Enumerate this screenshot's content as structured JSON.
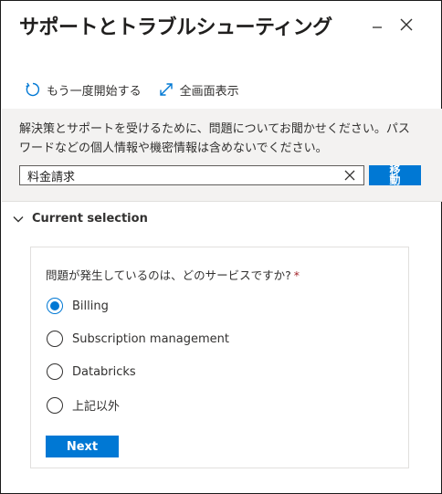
{
  "window": {
    "title": "サポートとトラブルシューティング",
    "minimize_icon": "minimize-icon",
    "close_icon": "close-icon"
  },
  "toolbar": {
    "restart_label": "もう一度開始する",
    "restart_icon": "refresh-icon",
    "fullscreen_label": "全画面表示",
    "fullscreen_icon": "expand-icon"
  },
  "search": {
    "description": "解決策とサポートを受けるために、問題についてお聞かせください。パスワードなどの個人情報や機密情報は含めないでください。",
    "value": "料金請求",
    "go_label": "移動"
  },
  "section": {
    "title": "Current selection",
    "expanded": true
  },
  "form": {
    "question": "問題が発生しているのは、どのサービスですか?",
    "required_marker": "*",
    "options": [
      {
        "label": "Billing",
        "selected": true
      },
      {
        "label": "Subscription management",
        "selected": false
      },
      {
        "label": "Databricks",
        "selected": false
      },
      {
        "label": "上記以外",
        "selected": false
      }
    ],
    "next_label": "Next"
  },
  "colors": {
    "accent": "#0078d4",
    "band": "#f3f2f1",
    "text": "#323130",
    "required": "#a4262c"
  }
}
